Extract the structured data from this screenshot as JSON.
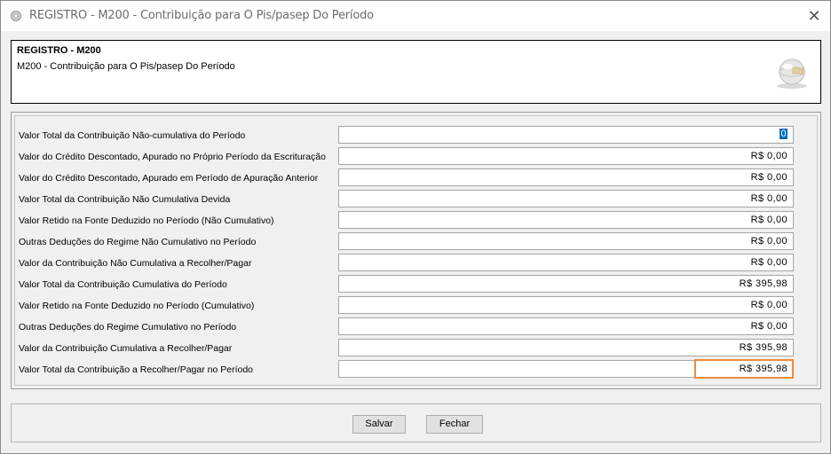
{
  "window": {
    "title": "REGISTRO - M200 - Contribuição para O Pis/pasep Do Período",
    "icon": "gear-icon",
    "close_glyph": "✕"
  },
  "header": {
    "title": "REGISTRO - M200",
    "subtitle": "M200 - Contribuição para O Pis/pasep Do Período",
    "logo": "globe-logo"
  },
  "fields": [
    {
      "label": "Valor Total da Contribuição Não-cumulativa do Período",
      "value": "0"
    },
    {
      "label": "Valor do Crédito Descontado, Apurado no Próprio Período da Escrituração",
      "value": "R$ 0,00"
    },
    {
      "label": "Valor do Crédito Descontado, Apurado em Período de Apuração Anterior",
      "value": "R$ 0,00"
    },
    {
      "label": "Valor Total da Contribuição Não Cumulativa Devida",
      "value": "R$ 0,00"
    },
    {
      "label": "Valor Retido na Fonte Deduzido no Período (Não Cumulativo)",
      "value": "R$ 0,00"
    },
    {
      "label": "Outras Deduções do Regime Não Cumulativo no Período",
      "value": "R$ 0,00"
    },
    {
      "label": "Valor da Contribuição Não Cumulativa a Recolher/Pagar",
      "value": "R$ 0,00"
    },
    {
      "label": "Valor Total da Contribuição Cumulativa do Período",
      "value": "R$ 395,98"
    },
    {
      "label": "Valor Retido na Fonte Deduzido no Período (Cumulativo)",
      "value": "R$ 0,00"
    },
    {
      "label": "Outras Deduções do Regime Cumulativo no Período",
      "value": "R$ 0,00"
    },
    {
      "label": "Valor da Contribuição Cumulativa a Recolher/Pagar",
      "value": "R$ 395,98"
    },
    {
      "label": "Valor Total da Contribuição a Recolher/Pagar no Período",
      "value": "R$ 395,98"
    }
  ],
  "buttons": {
    "save_label": "Salvar",
    "close_label": "Fechar"
  },
  "colors": {
    "highlight": "#f08a3a",
    "selection": "#0b6ab4"
  }
}
